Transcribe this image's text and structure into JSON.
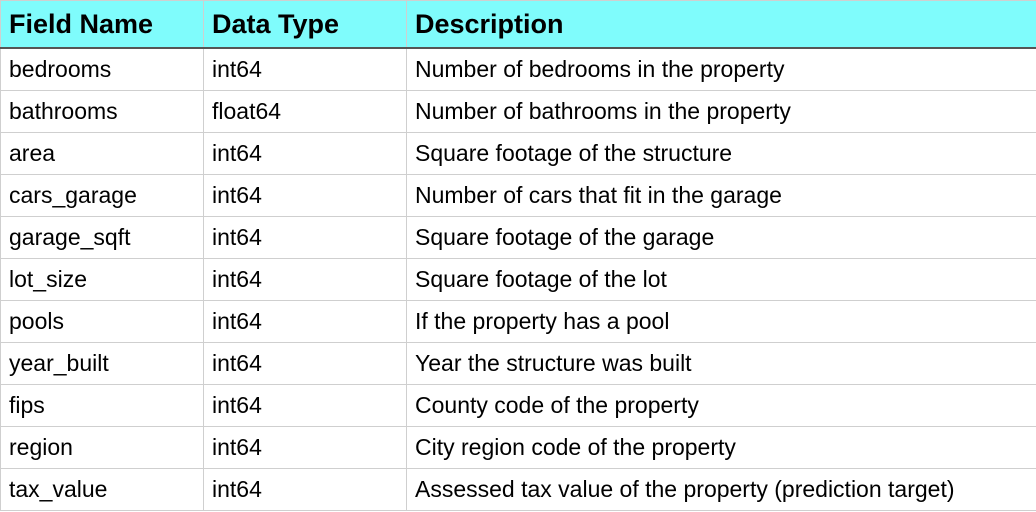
{
  "colors": {
    "header_background": "#7ffcfc",
    "grid_line": "#cfcfcf",
    "text": "#000000"
  },
  "table": {
    "headers": [
      "Field Name",
      "Data Type",
      "Description"
    ],
    "rows": [
      [
        "bedrooms",
        "int64",
        "Number of bedrooms in the property"
      ],
      [
        "bathrooms",
        "float64",
        "Number of bathrooms in the property"
      ],
      [
        "area",
        "int64",
        "Square footage of the structure"
      ],
      [
        "cars_garage",
        "int64",
        "Number of cars that fit in the garage"
      ],
      [
        "garage_sqft",
        "int64",
        "Square footage of the garage"
      ],
      [
        "lot_size",
        "int64",
        "Square footage of the lot"
      ],
      [
        "pools",
        "int64",
        "If the property has a pool"
      ],
      [
        "year_built",
        "int64",
        "Year the structure was built"
      ],
      [
        "fips",
        "int64",
        "County code of the property"
      ],
      [
        "region",
        "int64",
        "City region code of the property"
      ],
      [
        "tax_value",
        "int64",
        "Assessed tax value of the property (prediction target)"
      ]
    ]
  }
}
